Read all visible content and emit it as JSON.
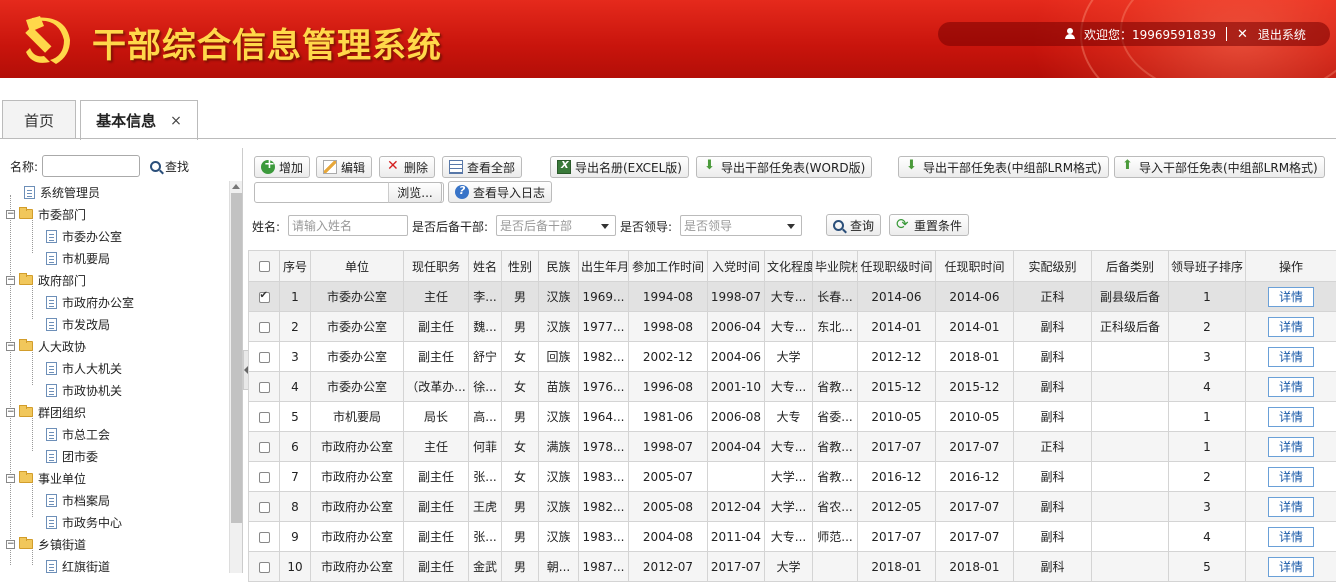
{
  "header": {
    "title": "干部综合信息管理系统",
    "welcome": "欢迎您：19969591839",
    "logout": "退出系统",
    "colors": {
      "primary_red": "#c8140c",
      "title_gold": "#ffd84a"
    }
  },
  "tabs": [
    {
      "label": "首页",
      "active": false
    },
    {
      "label": "基本信息",
      "active": true,
      "close": "×"
    }
  ],
  "sidebar": {
    "search_label": "名称:",
    "search_value": "",
    "find_label": "查找",
    "tree": [
      {
        "label": "系统管理员",
        "type": "doc",
        "level": 0
      },
      {
        "label": "市委部门",
        "type": "folder",
        "level": 0,
        "toggle": "−"
      },
      {
        "label": "市委办公室",
        "type": "doc",
        "level": 1
      },
      {
        "label": "市机要局",
        "type": "doc",
        "level": 1
      },
      {
        "label": "政府部门",
        "type": "folder",
        "level": 0,
        "toggle": "−"
      },
      {
        "label": "市政府办公室",
        "type": "doc",
        "level": 1
      },
      {
        "label": "市发改局",
        "type": "doc",
        "level": 1
      },
      {
        "label": "人大政协",
        "type": "folder",
        "level": 0,
        "toggle": "−"
      },
      {
        "label": "市人大机关",
        "type": "doc",
        "level": 1
      },
      {
        "label": "市政协机关",
        "type": "doc",
        "level": 1
      },
      {
        "label": "群团组织",
        "type": "folder",
        "level": 0,
        "toggle": "−"
      },
      {
        "label": "市总工会",
        "type": "doc",
        "level": 1
      },
      {
        "label": "团市委",
        "type": "doc",
        "level": 1
      },
      {
        "label": "事业单位",
        "type": "folder",
        "level": 0,
        "toggle": "−"
      },
      {
        "label": "市档案局",
        "type": "doc",
        "level": 1
      },
      {
        "label": "市政务中心",
        "type": "doc",
        "level": 1
      },
      {
        "label": "乡镇街道",
        "type": "folder",
        "level": 0,
        "toggle": "−"
      },
      {
        "label": "红旗街道",
        "type": "doc",
        "level": 1
      }
    ]
  },
  "toolbar": {
    "add": "增加",
    "edit": "编辑",
    "delete": "删除",
    "view_all": "查看全部",
    "export_excel": "导出名册(EXCEL版)",
    "export_word": "导出干部任免表(WORD版)",
    "export_lrm": "导出干部任免表(中组部LRM格式)",
    "import_lrm": "导入干部任免表(中组部LRM格式)",
    "browse": "浏览...",
    "import_log": "查看导入日志"
  },
  "filters": {
    "name_label": "姓名:",
    "name_placeholder": "请输入姓名",
    "reserve_label": "是否后备干部:",
    "reserve_placeholder": "是否后备干部",
    "leader_label": "是否领导:",
    "leader_placeholder": "是否领导",
    "query": "查询",
    "reset": "重置条件"
  },
  "table": {
    "columns": [
      "",
      "序号",
      "单位",
      "现任职务",
      "姓名",
      "性别",
      "民族",
      "出生年月",
      "参加工作时间",
      "入党时间",
      "文化程度",
      "毕业院校",
      "任现职级时间",
      "任现职时间",
      "实配级别",
      "后备类别",
      "领导班子排序",
      "操作"
    ],
    "detail_label": "详情",
    "rows": [
      [
        "1",
        "市委办公室",
        "主任",
        "李...",
        "男",
        "汉族",
        "1969...",
        "1994-08",
        "1998-07",
        "大专...",
        "长春...",
        "2014-06",
        "2014-06",
        "正科",
        "副县级后备",
        "1"
      ],
      [
        "2",
        "市委办公室",
        "副主任",
        "魏...",
        "男",
        "汉族",
        "1977...",
        "1998-08",
        "2006-04",
        "大专...",
        "东北...",
        "2014-01",
        "2014-01",
        "副科",
        "正科级后备",
        "2"
      ],
      [
        "3",
        "市委办公室",
        "副主任",
        "舒宁",
        "女",
        "回族",
        "1982...",
        "2002-12",
        "2004-06",
        "大学",
        "",
        "2012-12",
        "2018-01",
        "副科",
        "",
        "3"
      ],
      [
        "4",
        "市委办公室",
        "（改革办...",
        "徐...",
        "女",
        "苗族",
        "1976...",
        "1996-08",
        "2001-10",
        "大专...",
        "省教...",
        "2015-12",
        "2015-12",
        "副科",
        "",
        "4"
      ],
      [
        "5",
        "市机要局",
        "局长",
        "高...",
        "男",
        "汉族",
        "1964...",
        "1981-06",
        "2006-08",
        "大专",
        "省委...",
        "2010-05",
        "2010-05",
        "副科",
        "",
        "1"
      ],
      [
        "6",
        "市政府办公室",
        "主任",
        "何菲",
        "女",
        "满族",
        "1978...",
        "1998-07",
        "2004-04",
        "大专...",
        "省教...",
        "2017-07",
        "2017-07",
        "正科",
        "",
        "1"
      ],
      [
        "7",
        "市政府办公室",
        "副主任",
        "张...",
        "女",
        "汉族",
        "1983...",
        "2005-07",
        "",
        "大学...",
        "省教...",
        "2016-12",
        "2016-12",
        "副科",
        "",
        "2"
      ],
      [
        "8",
        "市政府办公室",
        "副主任",
        "王虎",
        "男",
        "汉族",
        "1982...",
        "2005-08",
        "2012-04",
        "大学...",
        "省农...",
        "2012-05",
        "2017-07",
        "副科",
        "",
        "3"
      ],
      [
        "9",
        "市政府办公室",
        "副主任",
        "张...",
        "男",
        "汉族",
        "1983...",
        "2004-08",
        "2011-04",
        "大专...",
        "师范...",
        "2017-07",
        "2017-07",
        "副科",
        "",
        "4"
      ],
      [
        "10",
        "市政府办公室",
        "副主任",
        "金武",
        "男",
        "朝...",
        "1987...",
        "2012-07",
        "2017-07",
        "大学",
        "",
        "2018-01",
        "2018-01",
        "副科",
        "",
        "5"
      ]
    ],
    "selected_row": 0
  }
}
